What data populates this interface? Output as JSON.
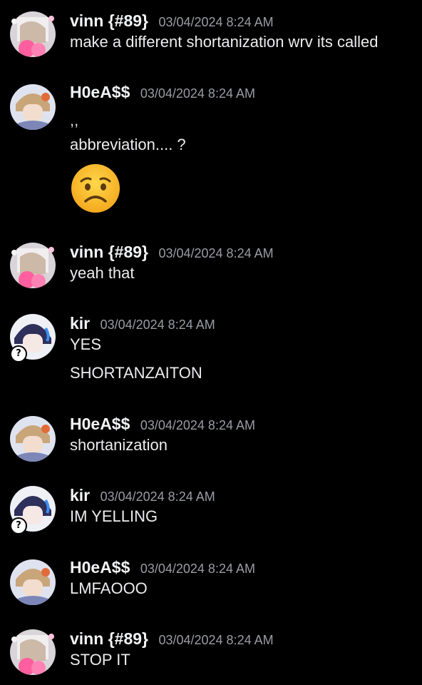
{
  "colors": {
    "background": "#000000",
    "text": "#ececef",
    "username": "#f2f3f5",
    "timestamp": "#9a9ca3"
  },
  "messages": [
    {
      "author": "vinn",
      "tag": "{#89}",
      "timestamp": "03/04/2024 8:24 AM",
      "avatar": "vinn-avatar",
      "lines": [
        "make a different shortanization wrv its called"
      ]
    },
    {
      "author": "H0eA$$",
      "tag": "",
      "timestamp": "03/04/2024 8:24 AM",
      "avatar": "hoeass-avatar",
      "lines": [
        ",,",
        "abbreviation.... ?"
      ],
      "emoji": "worried-face-emoji"
    },
    {
      "author": "vinn",
      "tag": "{#89}",
      "timestamp": "03/04/2024 8:24 AM",
      "avatar": "vinn-avatar",
      "lines": [
        "yeah that"
      ]
    },
    {
      "author": "kir",
      "tag": "",
      "timestamp": "03/04/2024 8:24 AM",
      "avatar": "kir-avatar",
      "badge": "?",
      "lines": [
        "YES",
        "SHORTANZAITON"
      ]
    },
    {
      "author": "H0eA$$",
      "tag": "",
      "timestamp": "03/04/2024 8:24 AM",
      "avatar": "hoeass-avatar",
      "lines": [
        "shortanization"
      ]
    },
    {
      "author": "kir",
      "tag": "",
      "timestamp": "03/04/2024 8:24 AM",
      "avatar": "kir-avatar",
      "badge": "?",
      "lines": [
        "IM YELLING"
      ]
    },
    {
      "author": "H0eA$$",
      "tag": "",
      "timestamp": "03/04/2024 8:24 AM",
      "avatar": "hoeass-avatar",
      "lines": [
        "LMFAOOO"
      ]
    },
    {
      "author": "vinn",
      "tag": "{#89}",
      "timestamp": "03/04/2024 8:24 AM",
      "avatar": "vinn-avatar",
      "lines": [
        "STOP IT"
      ]
    }
  ]
}
